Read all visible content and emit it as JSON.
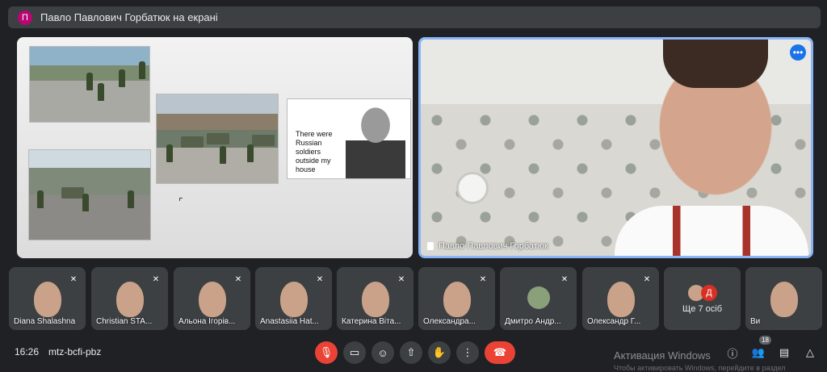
{
  "banner": {
    "avatar_letter": "П",
    "text": "Павло Павлович Горбатюк на екрані"
  },
  "slide": {
    "quote": "There were Russian soldiers outside my house"
  },
  "speaker": {
    "name": "Павло Павлович Горбатюк",
    "more": "•••"
  },
  "participants": [
    {
      "name": "Diana Shalashna"
    },
    {
      "name": "Christian STA..."
    },
    {
      "name": "Альона Ігорів..."
    },
    {
      "name": "Anastasiia Hat..."
    },
    {
      "name": "Катерина Віта..."
    },
    {
      "name": "Олександра..."
    },
    {
      "name": "Дмитро Андр..."
    },
    {
      "name": "Олександр Г..."
    }
  ],
  "others": {
    "label": "Ще 7 осіб",
    "avatar_letter": "Д"
  },
  "last_tile": {
    "name": "Ви"
  },
  "footer": {
    "time": "16:26",
    "meeting_code": "mtz-bcfi-pbz",
    "activation_title": "Активация Windows",
    "activation_sub": "Чтобы активировать Windows, перейдите в раздел",
    "people_count": "18"
  },
  "icons": {
    "mic_off": "mic-off-icon",
    "camera": "camera-icon",
    "emoji": "emoji-icon",
    "present": "present-icon",
    "hand": "raise-hand-icon",
    "more": "more-vert-icon",
    "end_call": "end-call-icon",
    "info": "info-icon",
    "people": "people-icon",
    "chat": "chat-icon",
    "activities": "activities-icon"
  },
  "colors": {
    "accent": "#8ab4f8",
    "danger": "#ea4335",
    "bg": "#202124"
  }
}
